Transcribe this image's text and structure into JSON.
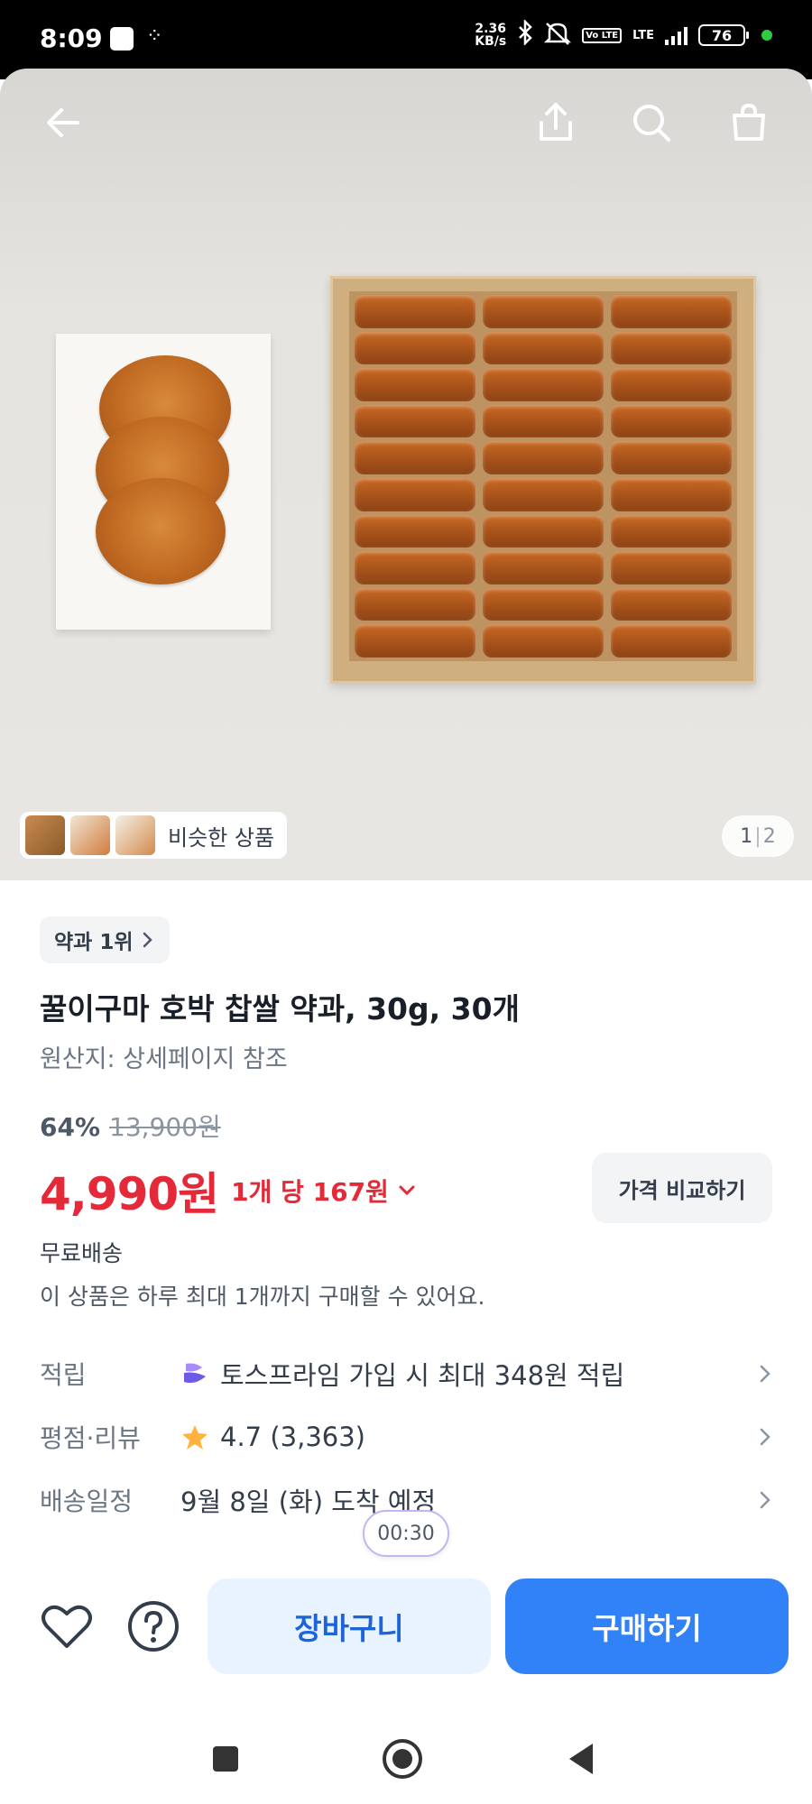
{
  "status_bar": {
    "time": "8:09",
    "net_speed_value": "2.36",
    "net_speed_unit": "KB/s",
    "volte": "Vo LTE",
    "network": "LTE",
    "battery": "76"
  },
  "hero": {
    "similar_label": "비슷한 상품",
    "page_current": "1",
    "page_total": "2"
  },
  "product": {
    "rank_label": "약과 1위",
    "title": "꿀이구마 호박 찹쌀 약과, 30g, 30개",
    "origin": "원산지: 상세페이지 참조",
    "discount": "64%",
    "original_price": "13,900원",
    "price": "4,990원",
    "unit_price": "1개 당 167원",
    "compare_label": "가격 비교하기",
    "shipping": "무료배송",
    "purchase_limit": "이 상품은 하루 최대 1개까지 구매할 수 있어요."
  },
  "info_rows": [
    {
      "label": "적립",
      "value": "토스프라임 가입 시 최대 348원 적립",
      "icon": "toss-prime-icon"
    },
    {
      "label": "평점·리뷰",
      "value": "4.7 (3,363)",
      "icon": "star-icon"
    },
    {
      "label": "배송일정",
      "value": "9월 8일 (화) 도착 예정",
      "icon": ""
    }
  ],
  "recording_badge": "00:30",
  "actions": {
    "cart": "장바구니",
    "buy": "구매하기"
  },
  "colors": {
    "price_red": "#e42939",
    "primary_blue": "#3182f6",
    "cart_bg": "#e8f3ff",
    "star": "#ffb33f"
  }
}
